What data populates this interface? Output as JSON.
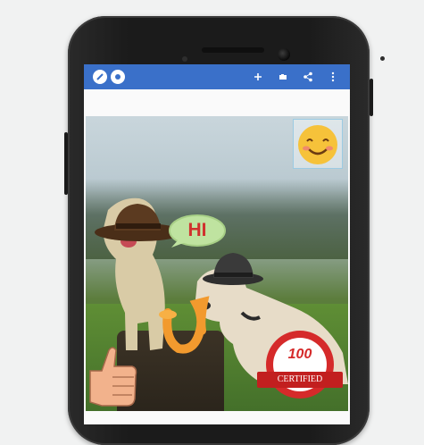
{
  "device": {
    "name": "android-phone"
  },
  "toolbar": {
    "left_icons": [
      "edit-icon",
      "circle-icon"
    ],
    "right_icons": [
      "plus-icon",
      "camera-icon",
      "share-icon",
      "more-vertical-icon"
    ]
  },
  "stickers": {
    "speech_bubble_text": "HI",
    "certified_badge_number": "100",
    "certified_badge_label": "CERTIFIED",
    "emoji": "smiling-face",
    "thumb": "thumbs-up"
  },
  "colors": {
    "toolbar_blue": "#3a70c9",
    "hat_brown": "#5b3a20",
    "bubble_green": "#bfe3a0",
    "bubble_text_red": "#d0312d",
    "badge_red": "#d52a2a",
    "emoji_yellow": "#f6c23a"
  }
}
